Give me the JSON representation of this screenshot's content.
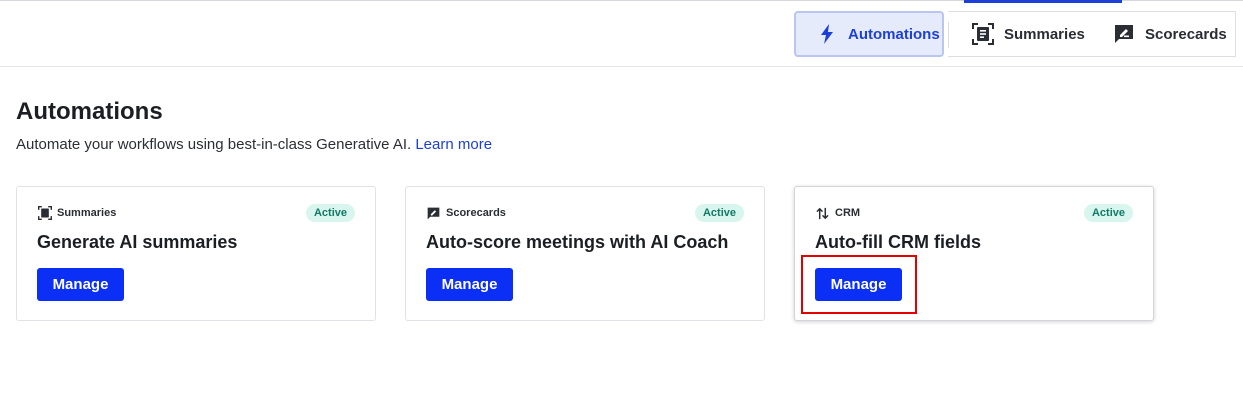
{
  "tabs": [
    {
      "label": "Automations",
      "icon": "bolt-icon",
      "active": true
    },
    {
      "label": "Summaries",
      "icon": "document-scan-icon",
      "active": false
    },
    {
      "label": "Scorecards",
      "icon": "scorecard-icon",
      "active": false
    }
  ],
  "header": {
    "title": "Automations",
    "subtitle": "Automate your workflows using best-in-class Generative AI.",
    "learn_more": "Learn more"
  },
  "cards": [
    {
      "category": "Summaries",
      "category_icon": "document-scan-icon",
      "status": "Active",
      "title": "Generate AI summaries",
      "button": "Manage"
    },
    {
      "category": "Scorecards",
      "category_icon": "scorecard-icon",
      "status": "Active",
      "title": "Auto-score meetings with AI Coach",
      "button": "Manage"
    },
    {
      "category": "CRM",
      "category_icon": "sync-arrows-icon",
      "status": "Active",
      "title": "Auto-fill CRM fields",
      "button": "Manage"
    }
  ],
  "colors": {
    "accent": "#0b2ff5",
    "active_tab_bg": "#e6ebfb",
    "badge_bg": "#d8f5ee",
    "badge_text": "#127a66",
    "highlight": "#e30000"
  }
}
